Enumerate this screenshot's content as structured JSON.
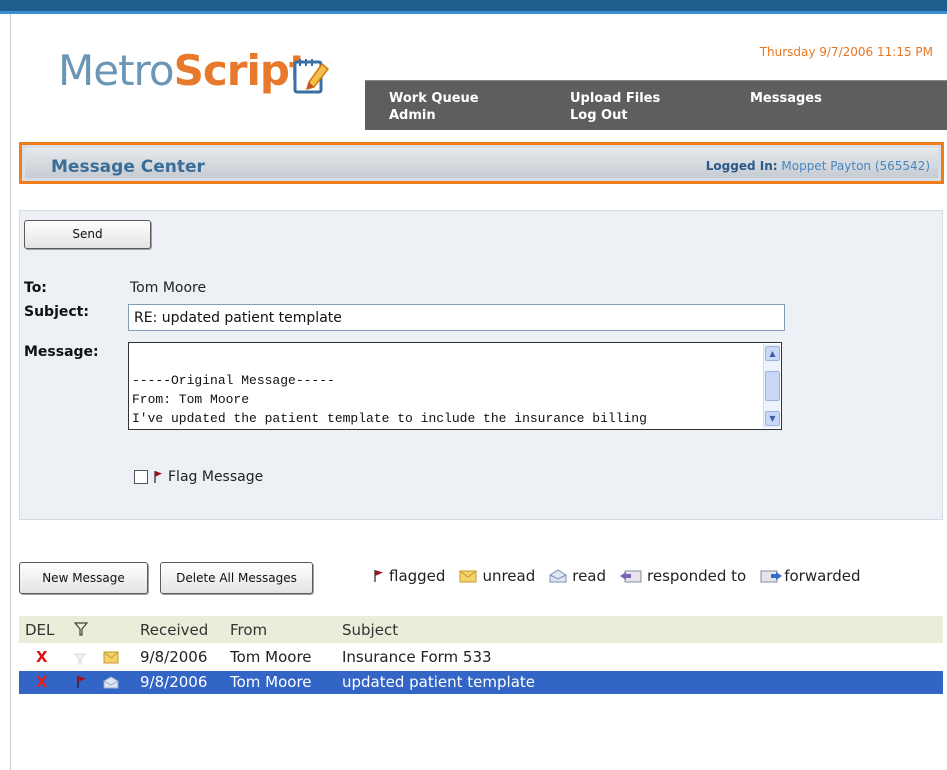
{
  "app": {
    "logo_part1": "Metro",
    "logo_part2": "Script",
    "datetime": "Thursday 9/7/2006 11:15 PM"
  },
  "nav": {
    "work_queue": "Work Queue",
    "admin": "Admin",
    "upload_files": "Upload Files",
    "log_out": "Log Out",
    "messages": "Messages"
  },
  "header": {
    "title": "Message Center",
    "logged_label": "Logged In:",
    "logged_user": "Moppet Payton (565542)"
  },
  "compose": {
    "send_label": "Send",
    "to_label": "To:",
    "to_value": "Tom Moore",
    "subject_label": "Subject:",
    "subject_value": "RE: updated patient template",
    "message_label": "Message:",
    "message_lines": [
      "-----Original Message-----",
      "From: Tom Moore",
      "I've updated the patient template to include the insurance billing"
    ],
    "flag_label": "Flag Message",
    "flag_checked": false
  },
  "actions": {
    "new_message": "New Message",
    "delete_all": "Delete All Messages"
  },
  "legend": {
    "flagged": "flagged",
    "unread": "unread",
    "read": "read",
    "responded": "responded to",
    "forwarded": "forwarded"
  },
  "table": {
    "headers": {
      "del": "DEL",
      "received": "Received",
      "from": "From",
      "subject": "Subject"
    },
    "rows": [
      {
        "del": "X",
        "received": "9/8/2006",
        "from": "Tom Moore",
        "subject": "Insurance Form 533",
        "flagged": false,
        "status": "unread",
        "selected": false
      },
      {
        "del": "X",
        "received": "9/8/2006",
        "from": "Tom Moore",
        "subject": "updated patient template",
        "flagged": true,
        "status": "read",
        "selected": true
      }
    ]
  },
  "colors": {
    "accent_orange": "#f07d1c",
    "brand_blue": "#1f5f8e",
    "nav_gray": "#5e5e5e",
    "selected_row": "#3265c6"
  }
}
